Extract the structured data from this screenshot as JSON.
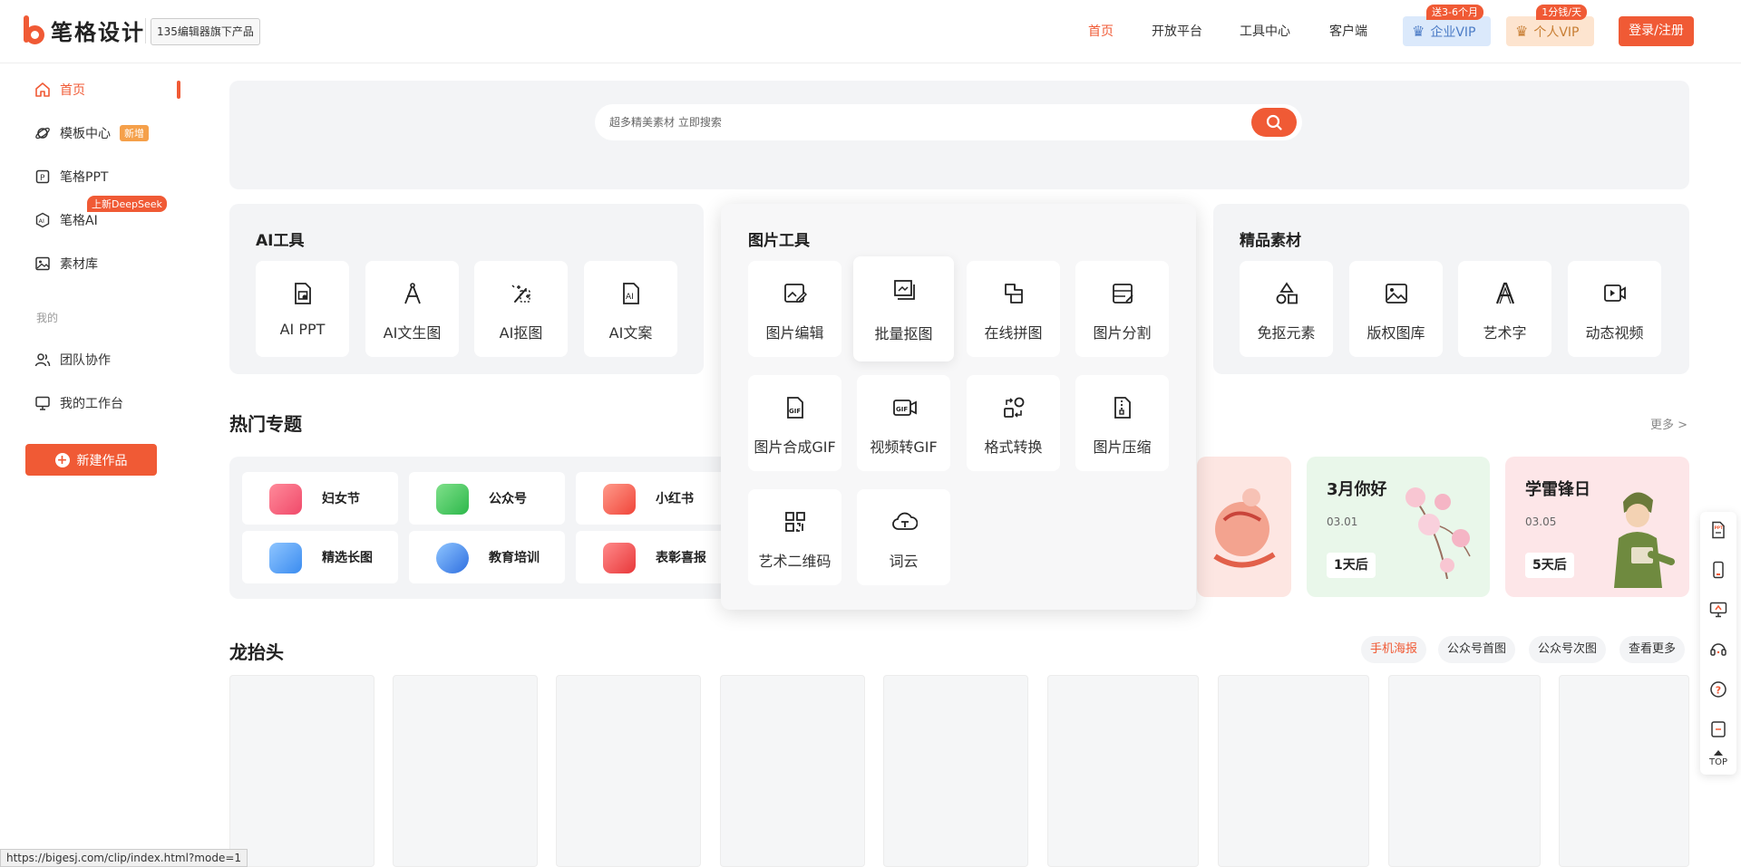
{
  "header": {
    "logo_text": "笔格设计",
    "logo_badge": "135编辑器旗下产品",
    "nav": [
      "首页",
      "开放平台",
      "工具中心",
      "客户端"
    ],
    "vip_enterprise": {
      "label": "企业VIP",
      "tag": "送3-6个月"
    },
    "vip_personal": {
      "label": "个人VIP",
      "tag": "1分钱/天"
    },
    "login": "登录/注册"
  },
  "sidebar": {
    "items": [
      "首页",
      "模板中心",
      "笔格PPT",
      "笔格AI",
      "素材库"
    ],
    "new_tag": "新增",
    "deepseek_tag": "上新DeepSeek",
    "section_label": "我的",
    "my_items": [
      "团队协作",
      "我的工作台"
    ],
    "new_work": "新建作品"
  },
  "search": {
    "placeholder": "超多精美素材 立即搜索"
  },
  "ai_tools": {
    "title": "AI工具",
    "items": [
      "AI PPT",
      "AI文生图",
      "AI抠图",
      "AI文案"
    ]
  },
  "image_tools": {
    "title": "图片工具",
    "items": [
      "图片编辑",
      "批量抠图",
      "在线拼图",
      "图片分割",
      "图片合成GIF",
      "视频转GIF",
      "格式转换",
      "图片压缩",
      "艺术二维码",
      "词云"
    ]
  },
  "materials": {
    "title": "精品素材",
    "items": [
      "免抠元素",
      "版权图库",
      "艺术字",
      "动态视频"
    ]
  },
  "hot_topics": {
    "title": "热门专题",
    "more": "更多 >",
    "topics": [
      "妇女节",
      "公众号",
      "小红书",
      "精选长图",
      "教育培训",
      "表彰喜报"
    ],
    "promos": [
      {
        "title": "3月你好",
        "date": "03.01",
        "badge": "1天后"
      },
      {
        "title": "学雷锋日",
        "date": "03.05",
        "badge": "5天后"
      }
    ]
  },
  "dragon": {
    "title": "龙抬头",
    "filters": [
      "手机海报",
      "公众号首图",
      "公众号次图",
      "查看更多"
    ]
  },
  "right_toolbar": {
    "top_label": "TOP"
  },
  "status_url": "https://bigesj.com/clip/index.html?mode=1",
  "colors": {
    "accent": "#f05a35",
    "panel_bg": "#f3f4f6"
  }
}
